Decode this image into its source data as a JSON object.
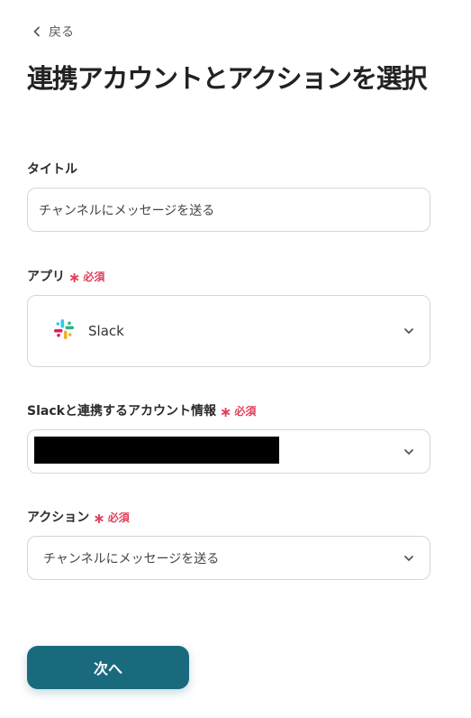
{
  "nav": {
    "back_label": "戻る"
  },
  "page": {
    "title": "連携アカウントとアクションを選択"
  },
  "form": {
    "title_field": {
      "label": "タイトル",
      "value": "チャンネルにメッセージを送る"
    },
    "app_field": {
      "label": "アプリ",
      "required_label": "必須",
      "selected": "Slack",
      "icon": "slack-logo"
    },
    "account_field": {
      "label": "Slackと連携するアカウント情報",
      "required_label": "必須",
      "selected_redacted": true
    },
    "action_field": {
      "label": "アクション",
      "required_label": "必須",
      "selected": "チャンネルにメッセージを送る"
    }
  },
  "actions": {
    "next_label": "次へ"
  },
  "colors": {
    "primary_button": "#1a6a7e",
    "required": "#e0405a",
    "border": "#d3d6da"
  }
}
